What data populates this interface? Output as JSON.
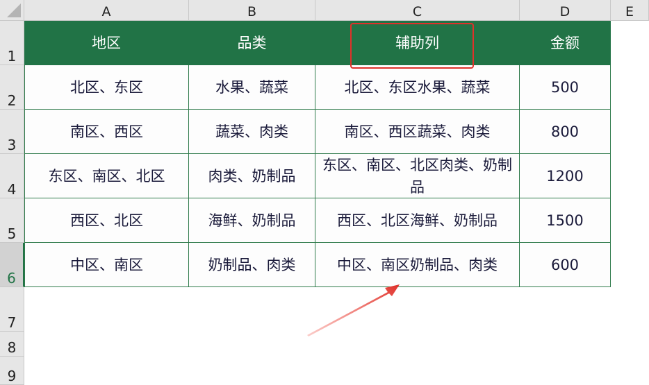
{
  "columns": [
    "A",
    "B",
    "C",
    "D",
    "E"
  ],
  "rows": [
    "1",
    "2",
    "3",
    "4",
    "5",
    "6",
    "7",
    "8",
    "9"
  ],
  "selected_row": "6",
  "table": {
    "headers": [
      "地区",
      "品类",
      "辅助列",
      "金额"
    ],
    "data": [
      [
        "北区、东区",
        "水果、蔬菜",
        "北区、东区水果、蔬菜",
        "500"
      ],
      [
        "南区、西区",
        "蔬菜、肉类",
        "南区、西区蔬菜、肉类",
        "800"
      ],
      [
        "东区、南区、北区",
        "肉类、奶制品",
        "东区、南区、北区肉类、奶制品",
        "1200"
      ],
      [
        "西区、北区",
        "海鲜、奶制品",
        "西区、北区海鲜、奶制品",
        "1500"
      ],
      [
        "中区、南区",
        "奶制品、肉类",
        "中区、南区奶制品、肉类",
        "600"
      ]
    ]
  },
  "colors": {
    "header_bg": "#217346",
    "annotation": "#e0312a"
  }
}
